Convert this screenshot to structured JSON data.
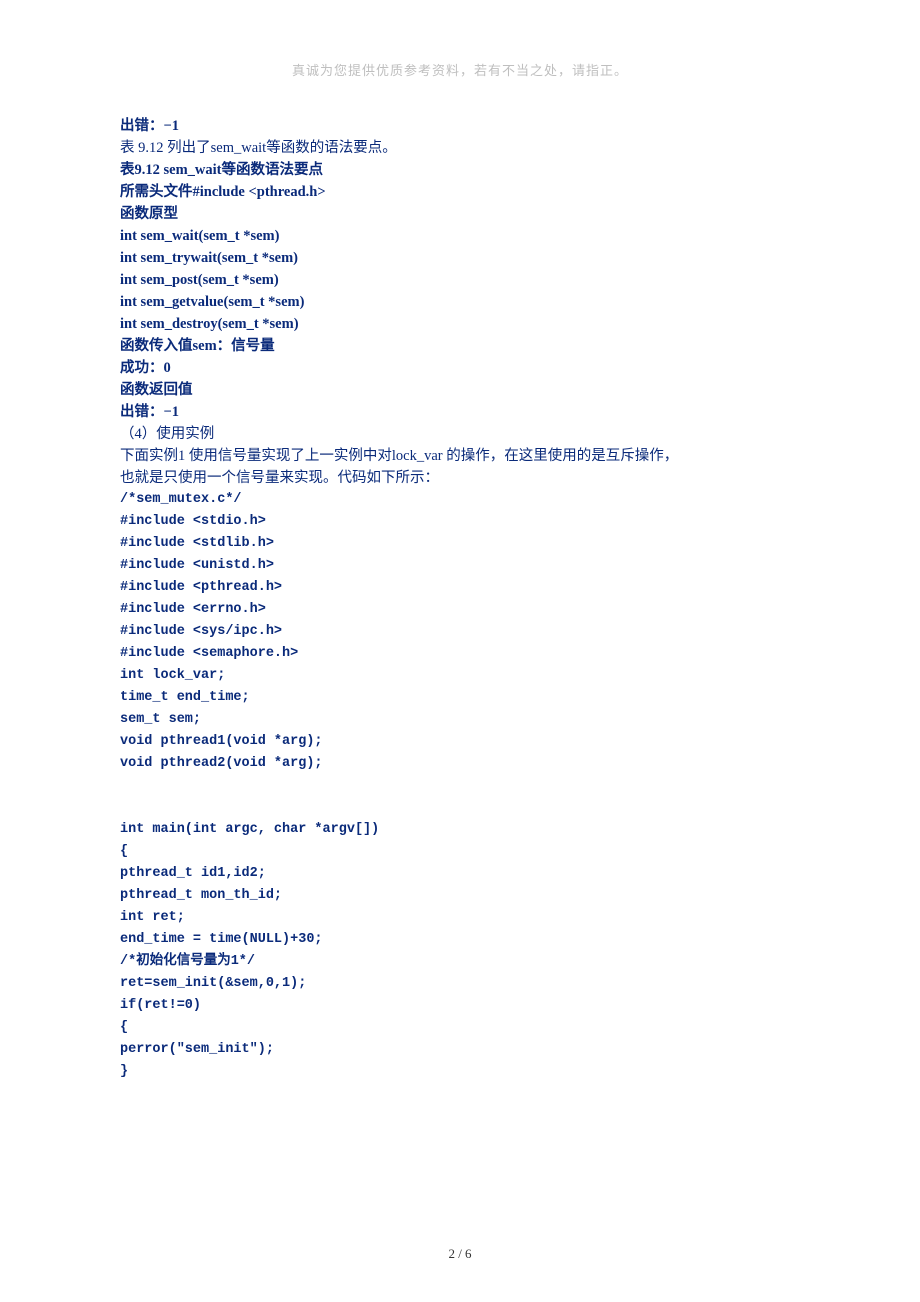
{
  "header_note": "真诚为您提供优质参考资料，若有不当之处，请指正。",
  "lines": [
    {
      "cls": "line bold",
      "t": "出错：−1"
    },
    {
      "cls": "line",
      "t": "表 9.12 列出了sem_wait等函数的语法要点。"
    },
    {
      "cls": "line bold",
      "t": "表9.12 sem_wait等函数语法要点"
    },
    {
      "cls": "line bold",
      "t": "所需头文件#include <pthread.h>"
    },
    {
      "cls": "line bold",
      "t": "函数原型"
    },
    {
      "cls": "line bold",
      "t": "int sem_wait(sem_t *sem)"
    },
    {
      "cls": "line bold",
      "t": "int sem_trywait(sem_t *sem)"
    },
    {
      "cls": "line bold",
      "t": "int sem_post(sem_t *sem)"
    },
    {
      "cls": "line bold",
      "t": "int sem_getvalue(sem_t *sem)"
    },
    {
      "cls": "line bold",
      "t": "int sem_destroy(sem_t *sem)"
    },
    {
      "cls": "line bold",
      "t": "函数传入值sem：信号量"
    },
    {
      "cls": "line bold",
      "t": "成功：0"
    },
    {
      "cls": "line bold",
      "t": "函数返回值"
    },
    {
      "cls": "line bold",
      "t": "出错：−1"
    },
    {
      "cls": "line",
      "t": "（4）使用实例"
    },
    {
      "cls": "line",
      "t": "下面实例1 使用信号量实现了上一实例中对lock_var 的操作，在这里使用的是互斥操作，"
    },
    {
      "cls": "line",
      "t": "也就是只使用一个信号量来实现。代码如下所示："
    },
    {
      "cls": "line code",
      "t": "/*sem_mutex.c*/"
    },
    {
      "cls": "line code",
      "t": "#include <stdio.h>"
    },
    {
      "cls": "line code",
      "t": "#include <stdlib.h>"
    },
    {
      "cls": "line code",
      "t": "#include <unistd.h>"
    },
    {
      "cls": "line code",
      "t": "#include <pthread.h>"
    },
    {
      "cls": "line code",
      "t": "#include <errno.h>"
    },
    {
      "cls": "line code",
      "t": "#include <sys/ipc.h>"
    },
    {
      "cls": "line code",
      "t": "#include <semaphore.h>"
    },
    {
      "cls": "line code",
      "t": "int lock_var;"
    },
    {
      "cls": "line code",
      "t": "time_t end_time;"
    },
    {
      "cls": "line code",
      "t": "sem_t sem;"
    },
    {
      "cls": "line code",
      "t": "void pthread1(void *arg);"
    },
    {
      "cls": "line code",
      "t": "void pthread2(void *arg);"
    },
    {
      "cls": "spacer",
      "t": ""
    },
    {
      "cls": "spacer",
      "t": ""
    },
    {
      "cls": "line code",
      "t": "int main(int argc, char *argv[])"
    },
    {
      "cls": "line code",
      "t": "{"
    },
    {
      "cls": "line code",
      "t": "pthread_t id1,id2;"
    },
    {
      "cls": "line code",
      "t": "pthread_t mon_th_id;"
    },
    {
      "cls": "line code",
      "t": "int ret;"
    },
    {
      "cls": "line code",
      "t": "end_time = time(NULL)+30;"
    },
    {
      "cls": "line code",
      "t": "/*初始化信号量为1*/"
    },
    {
      "cls": "line code",
      "t": "ret=sem_init(&sem,0,1);"
    },
    {
      "cls": "line code",
      "t": "if(ret!=0)"
    },
    {
      "cls": "line code",
      "t": "{"
    },
    {
      "cls": "line code",
      "t": "perror(\"sem_init\");"
    },
    {
      "cls": "line code",
      "t": "}"
    }
  ],
  "footer": "2 / 6"
}
